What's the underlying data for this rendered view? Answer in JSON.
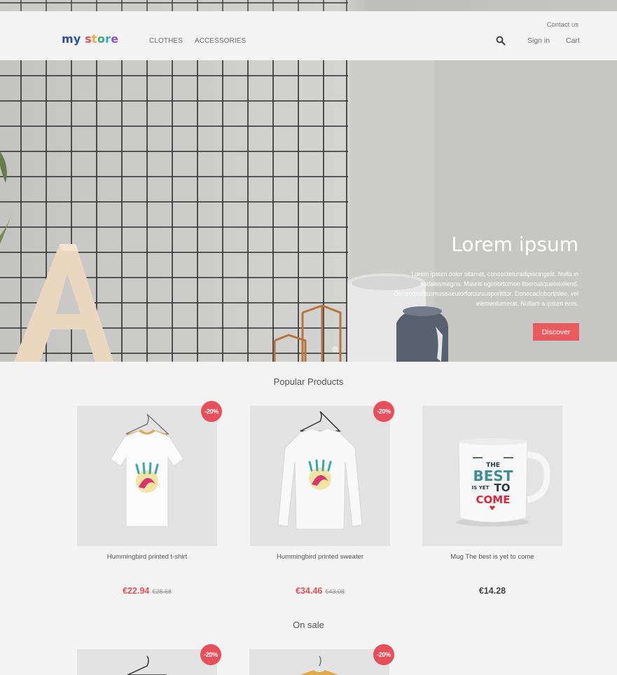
{
  "header": {
    "logo": {
      "my": "my",
      "store": [
        "s",
        "t",
        "o",
        "r",
        "e"
      ]
    },
    "nav": [
      "CLOTHES",
      "ACCESSORIES"
    ],
    "contact": "Contact us",
    "sign_in": "Sign in",
    "cart": "Cart",
    "search_icon": "search-icon"
  },
  "hero": {
    "title": "Lorem ipsum",
    "text": "Lorem ipsum dolor sitamet, consecteturadipiscingelit. Nulla in sodalesmagna. Mauris egetlortornon liberoaliqueteleifend. Donecdapibusmassaeutorforcursusporttitor. Donecaclobortisleo, vel elementumerat. Nullam a ipsum eros.",
    "button": "Discover"
  },
  "popular": {
    "title": "Popular Products",
    "products": [
      {
        "name": "Hummingbird printed t-shirt",
        "price": "€22.94",
        "old_price": "€28.68",
        "badge": "-20%"
      },
      {
        "name": "Hummingbird printed sweater",
        "price": "€34.46",
        "old_price": "€43.08",
        "badge": "-20%"
      },
      {
        "name": "Mug The best is yet to come",
        "price": "€14.28",
        "old_price": "",
        "badge": ""
      }
    ]
  },
  "on_sale": {
    "title": "On sale",
    "badges": [
      "-20%",
      "-20%"
    ]
  },
  "mug_print": {
    "line1": "THE",
    "line2": "BEST",
    "line3": "IS YET",
    "line4": "TO",
    "line5": "COME"
  },
  "colors": {
    "accent": "#e7505a",
    "background": "#f4f4f4"
  }
}
